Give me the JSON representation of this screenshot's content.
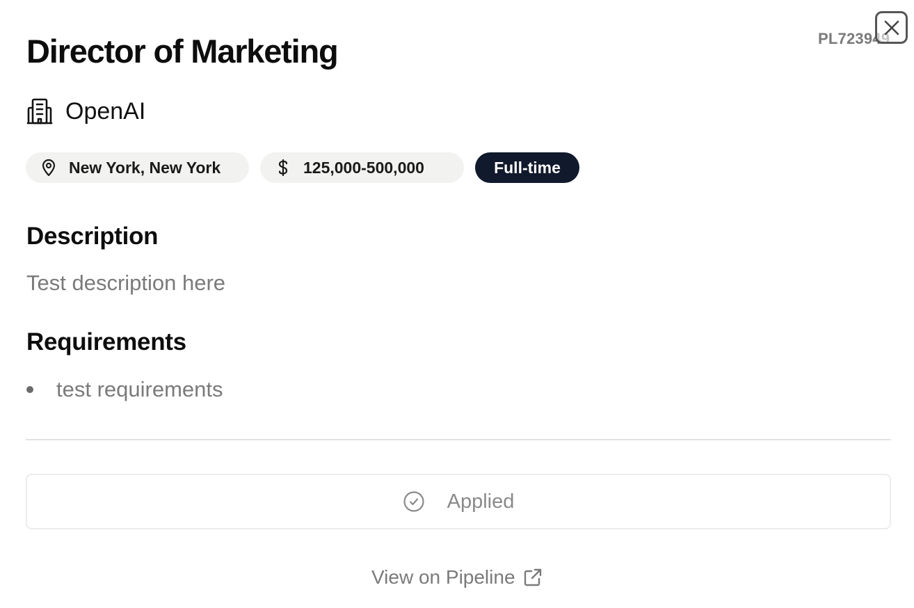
{
  "job": {
    "id": "PL723949",
    "title": "Director of Marketing",
    "company": "OpenAI",
    "location": "New York, New York",
    "salary": "125,000-500,000",
    "employment_type": "Full-time"
  },
  "sections": {
    "description_heading": "Description",
    "description_text": "Test description here",
    "requirements_heading": "Requirements",
    "requirements": [
      "test requirements"
    ]
  },
  "actions": {
    "applied_label": "Applied",
    "view_link_label": "View on Pipeline"
  },
  "icons": {
    "close": "close-icon",
    "company": "building-icon",
    "location": "map-pin-icon",
    "salary": "dollar-icon",
    "applied": "check-circle-icon",
    "external": "external-link-icon"
  },
  "colors": {
    "chip_background": "#f2f2f1",
    "badge_background": "#111a2c",
    "badge_text": "#ffffff",
    "muted_text": "#7a7a7a"
  }
}
